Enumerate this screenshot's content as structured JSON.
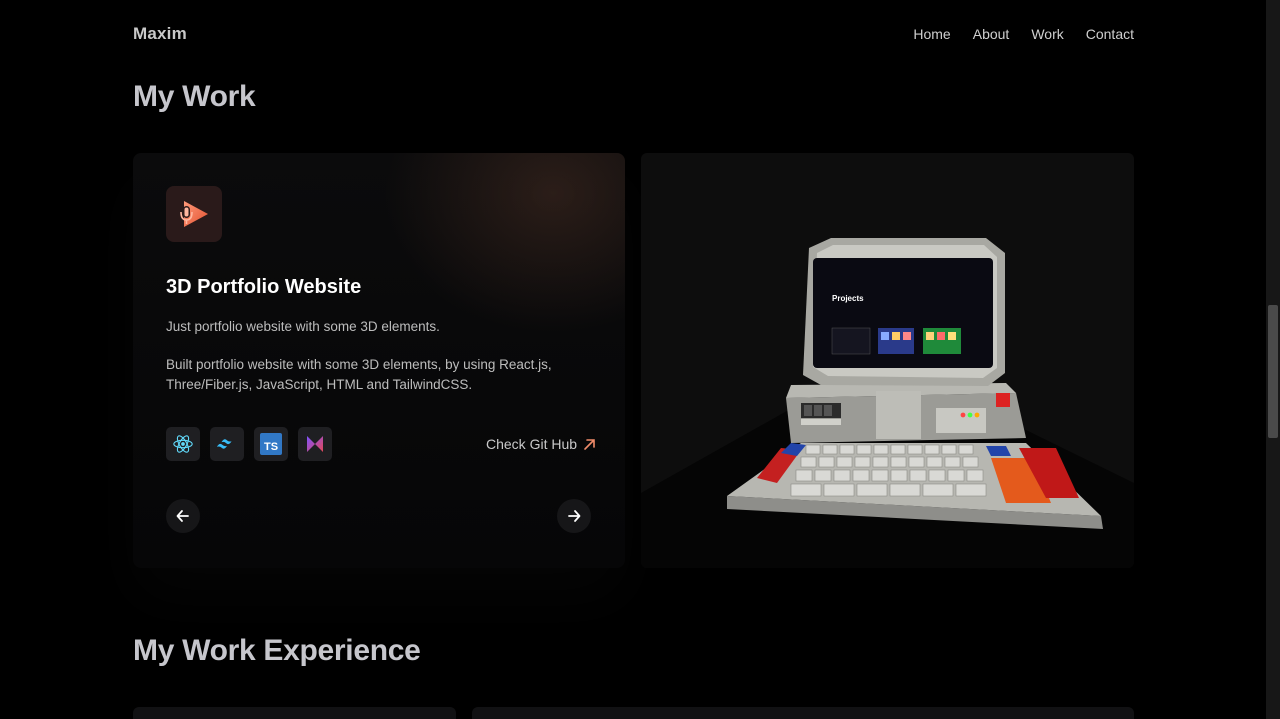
{
  "nav": {
    "brand": "Maxim",
    "links": [
      "Home",
      "About",
      "Work",
      "Contact"
    ]
  },
  "work_section": {
    "title": "My Work",
    "project": {
      "title": "3D Portfolio Website",
      "short_description": "Just portfolio website with some 3D elements.",
      "description": "Built portfolio website with some 3D elements, by using React.js, Three/Fiber.js, JavaScript, HTML and TailwindCSS.",
      "tech_icons": [
        "react-icon",
        "tailwind-icon",
        "typescript-icon",
        "kotlin-icon"
      ],
      "typescript_badge": "TS",
      "link_label": "Check Git Hub",
      "preview": {
        "screen_heading": "Projects"
      }
    }
  },
  "experience_section": {
    "title": "My Work Experience"
  },
  "colors": {
    "accent": "#f08c6a",
    "background": "#000000"
  }
}
